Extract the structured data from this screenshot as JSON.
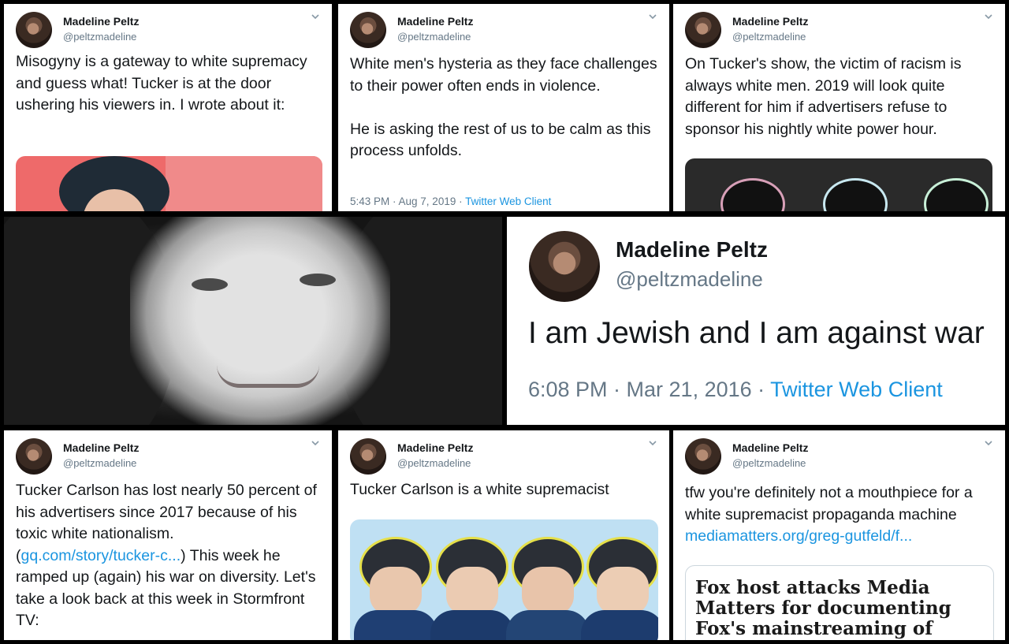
{
  "colors": {
    "link": "#1b95e0",
    "text": "#14171a",
    "muted": "#657786"
  },
  "tweets": [
    {
      "name": "Madeline Peltz",
      "handle": "@peltzmadeline",
      "text": "Misogyny is a gateway to white supremacy and guess what! Tucker is at the door ushering his viewers in. I wrote about it:"
    },
    {
      "name": "Madeline Peltz",
      "handle": "@peltzmadeline",
      "text": "White men's hysteria as they face challenges to their power often ends in violence.\n\nHe is asking the rest of us to be calm as this process unfolds.",
      "time": "5:43 PM · Aug 7, 2019 · ",
      "client": "Twitter Web Client"
    },
    {
      "name": "Madeline Peltz",
      "handle": "@peltzmadeline",
      "text": "On Tucker's show, the victim of racism is always white men. 2019 will look quite different for him if advertisers refuse to sponsor his nightly white power hour."
    },
    {
      "name": "Madeline Peltz",
      "handle": "@peltzmadeline",
      "text": "I am Jewish and I am against war",
      "time": "6:08 PM · Mar 21, 2016 · ",
      "client": "Twitter Web Client"
    },
    {
      "name": "Madeline Peltz",
      "handle": "@peltzmadeline",
      "text_a": "Tucker Carlson has lost nearly 50 percent of his advertisers since 2017 because of his toxic white nationalism. (",
      "link": "gq.com/story/tucker-c...",
      "text_b": ") This week he ramped up (again) his war on diversity. Let's take a look back at this week in Stormfront TV:"
    },
    {
      "name": "Madeline Peltz",
      "handle": "@peltzmadeline",
      "text": "Tucker Carlson is a white supremacist"
    },
    {
      "name": "Madeline Peltz",
      "handle": "@peltzmadeline",
      "text": "tfw you're definitely not a mouthpiece for a white supremacist propaganda machine",
      "link": "mediamatters.org/greg-gutfeld/f...",
      "card_headline": "Fox host attacks Media Matters for documenting Fox's mainstreaming of white"
    }
  ]
}
